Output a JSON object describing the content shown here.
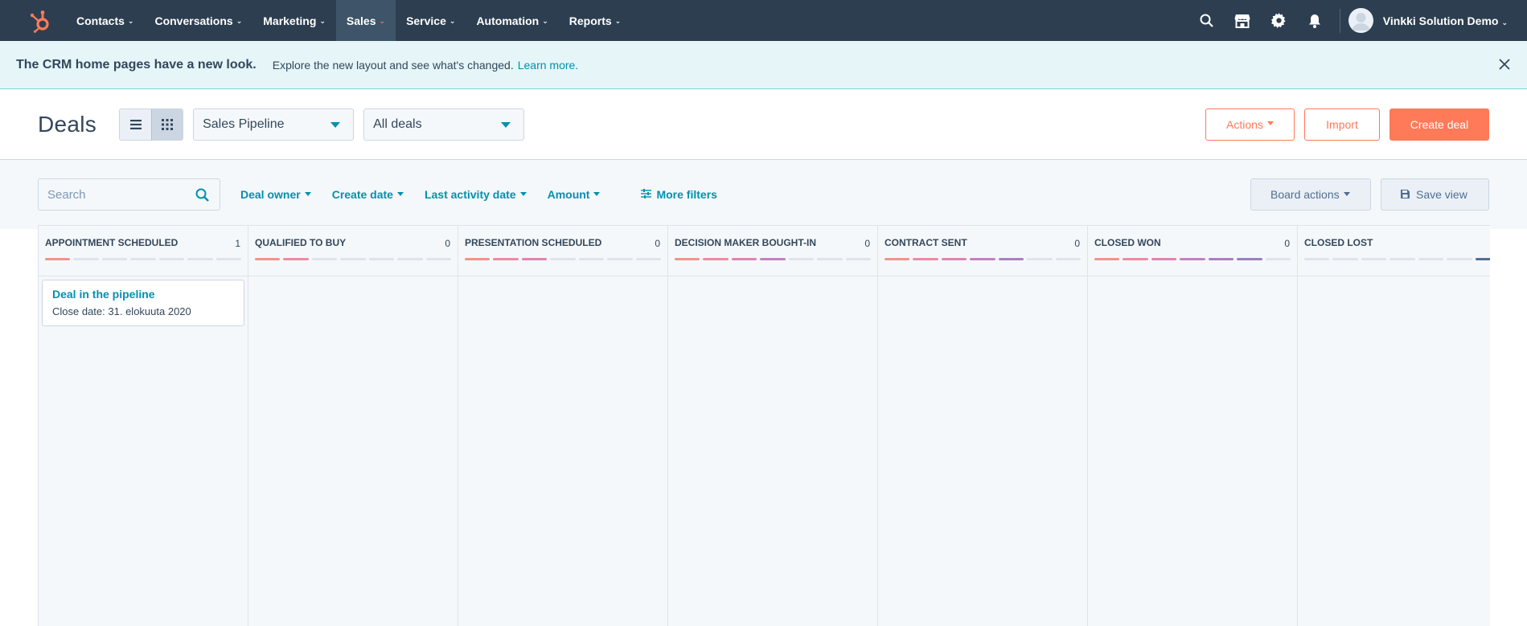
{
  "nav": {
    "items": [
      {
        "label": "Contacts",
        "active": false
      },
      {
        "label": "Conversations",
        "active": false
      },
      {
        "label": "Marketing",
        "active": false
      },
      {
        "label": "Sales",
        "active": true
      },
      {
        "label": "Service",
        "active": false
      },
      {
        "label": "Automation",
        "active": false
      },
      {
        "label": "Reports",
        "active": false
      }
    ],
    "account": "Vinkki Solution Demo"
  },
  "banner": {
    "title": "The CRM home pages have a new look.",
    "text": "Explore the new layout and see what's changed.",
    "link": "Learn more."
  },
  "header": {
    "title": "Deals",
    "pipeline": "Sales Pipeline",
    "view": "All deals",
    "actions": "Actions",
    "import": "Import",
    "create": "Create deal"
  },
  "filters": {
    "search_placeholder": "Search",
    "deal_owner": "Deal owner",
    "create_date": "Create date",
    "last_activity": "Last activity date",
    "amount": "Amount",
    "more": "More filters",
    "board_actions": "Board actions",
    "save_view": "Save view"
  },
  "colors": {
    "accent": "#ff7a59",
    "link": "#0091ae",
    "nav": "#2d3e50",
    "stage": [
      "#f2938b",
      "#ee8aa1",
      "#e382b3",
      "#c681bf",
      "#a97fc2",
      "#9c7ec3"
    ],
    "lost": "#516f90"
  },
  "board": {
    "stages": [
      {
        "name": "APPOINTMENT SCHEDULED",
        "count": "1",
        "filled": 1,
        "cards": [
          {
            "title": "Deal in the pipeline",
            "prop_label": "Close date:",
            "prop_value": "31. elokuuta 2020"
          }
        ]
      },
      {
        "name": "QUALIFIED TO BUY",
        "count": "0",
        "filled": 2,
        "cards": []
      },
      {
        "name": "PRESENTATION SCHEDULED",
        "count": "0",
        "filled": 3,
        "cards": []
      },
      {
        "name": "DECISION MAKER BOUGHT-IN",
        "count": "0",
        "filled": 4,
        "cards": []
      },
      {
        "name": "CONTRACT SENT",
        "count": "0",
        "filled": 5,
        "cards": []
      },
      {
        "name": "CLOSED WON",
        "count": "0",
        "filled": 6,
        "cards": []
      },
      {
        "name": "CLOSED LOST",
        "count": "",
        "filled": 0,
        "lost": true,
        "cards": []
      }
    ]
  }
}
